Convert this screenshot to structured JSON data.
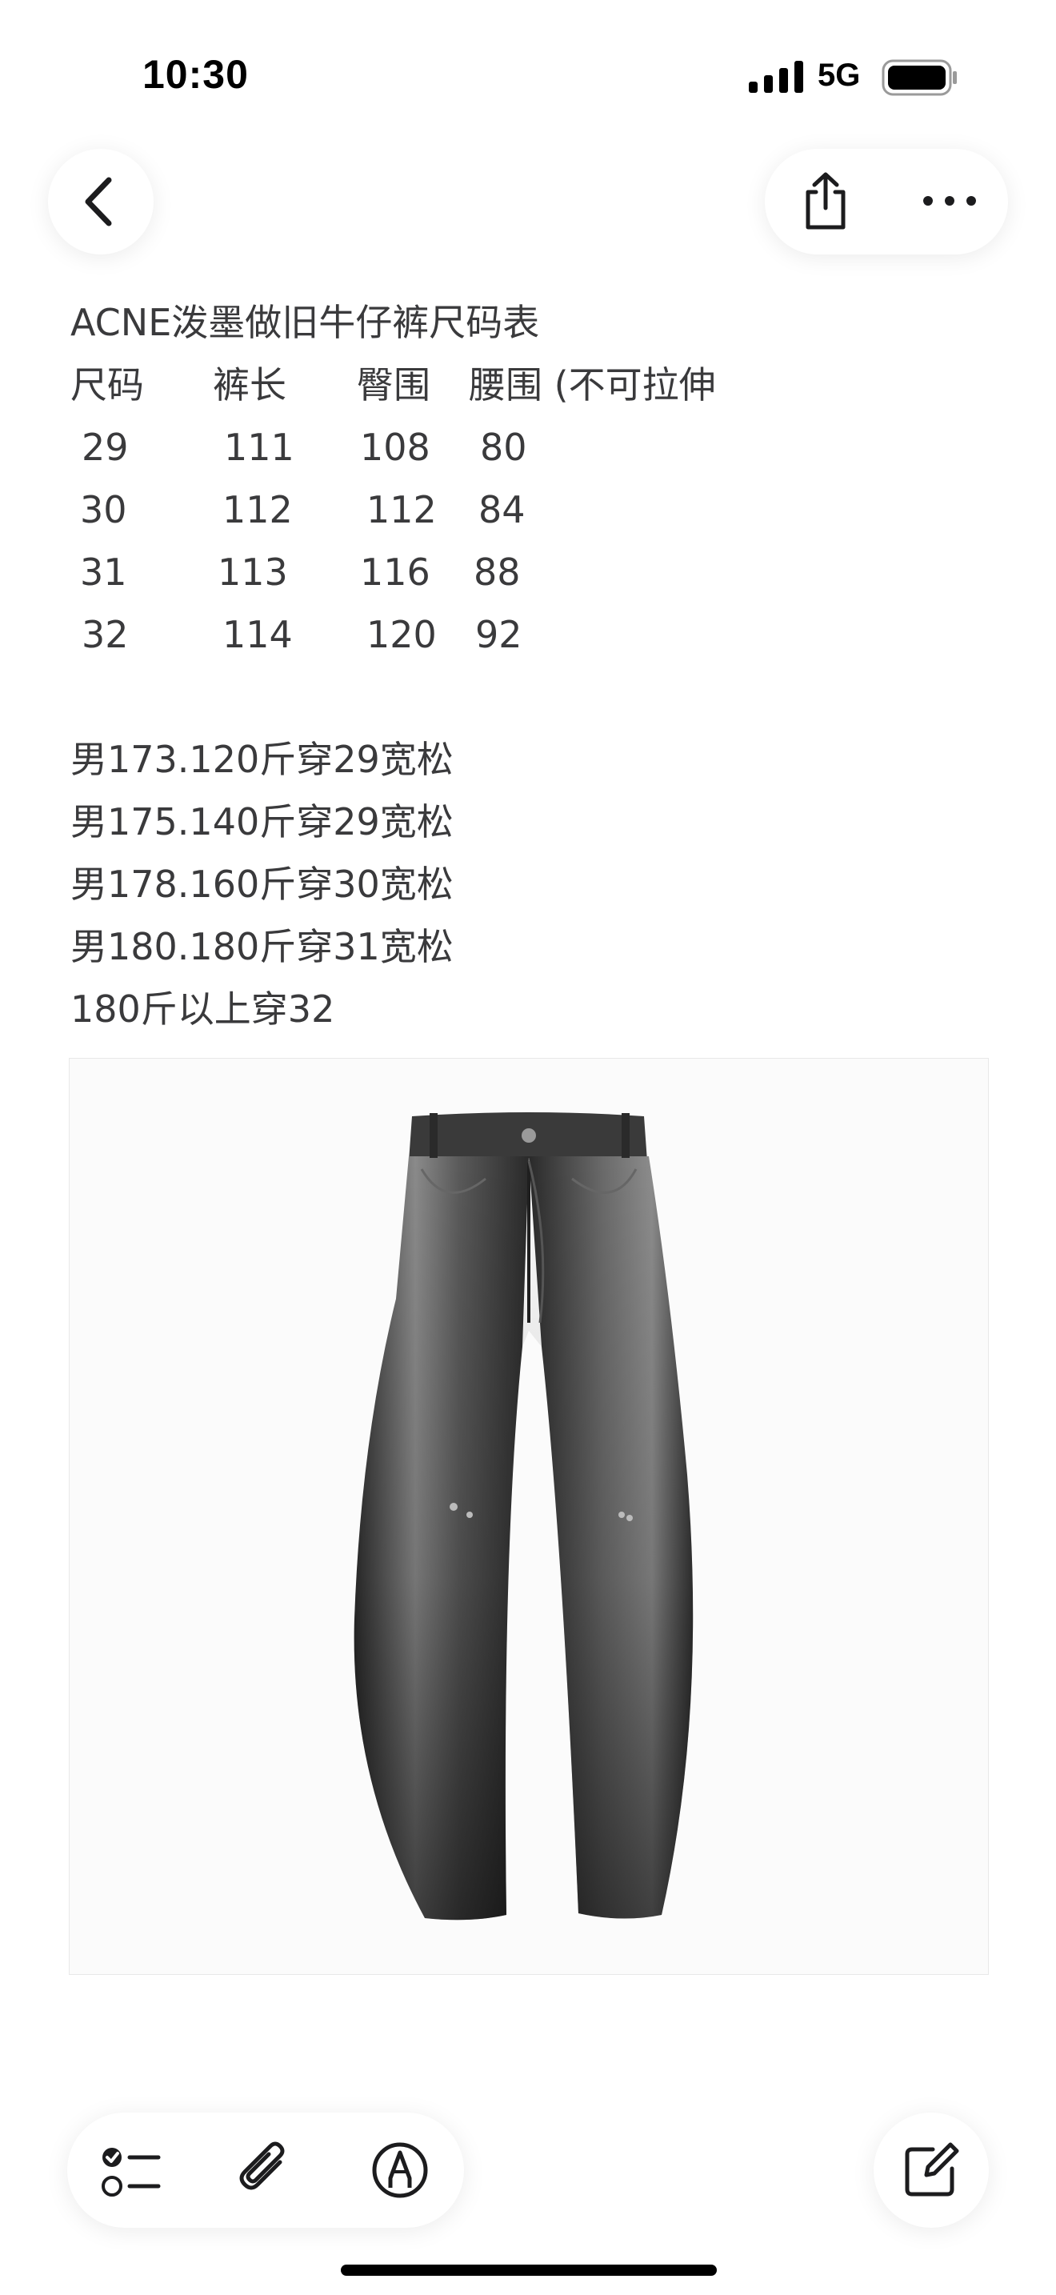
{
  "status_bar": {
    "time": "10:30",
    "network": "5G"
  },
  "note": {
    "title": "ACNE泼墨做旧牛仔裤尺码表",
    "size_table": {
      "headers": [
        "尺码",
        "裤长",
        "臀围",
        "腰围 (不可拉伸"
      ],
      "rows": [
        [
          "29",
          "111",
          "108",
          "80"
        ],
        [
          "30",
          "112",
          "112",
          "84"
        ],
        [
          "31",
          "113",
          "116",
          "88"
        ],
        [
          "32",
          "114",
          "120",
          "92"
        ]
      ]
    },
    "recommendations": [
      "男173.120斤穿29宽松",
      "男175.140斤穿29宽松",
      "男178.160斤穿30宽松",
      "男180.180斤穿31宽松",
      "180斤以上穿32"
    ]
  },
  "icons": {
    "back": "chevron-left-icon",
    "share": "share-icon",
    "more": "more-icon",
    "checklist": "checklist-icon",
    "attach": "paperclip-icon",
    "markup": "markup-pen-icon",
    "compose": "compose-icon"
  }
}
